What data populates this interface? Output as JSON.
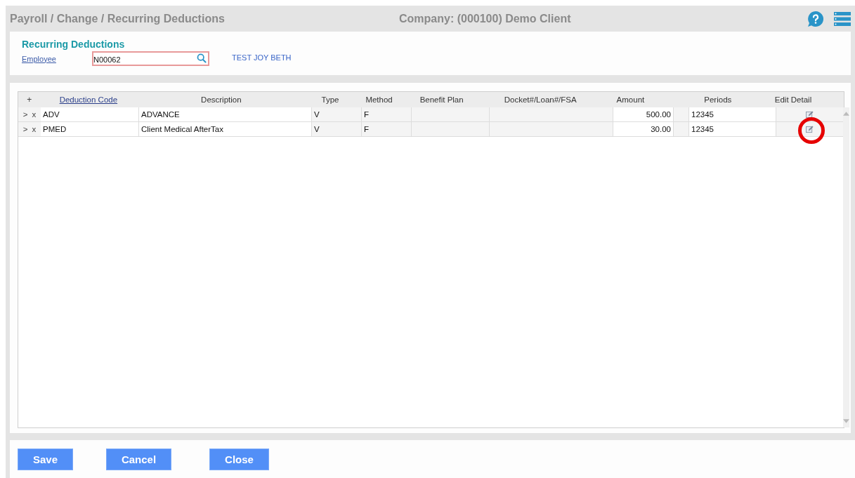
{
  "header": {
    "breadcrumb": "Payroll / Change / Recurring Deductions",
    "company": "Company: (000100) Demo Client"
  },
  "form": {
    "title": "Recurring Deductions",
    "employee_label": "Employee",
    "employee_value": "N00062",
    "employee_name": "TEST JOY BETH"
  },
  "table": {
    "add": "+",
    "columns": [
      {
        "label": "Deduction Code",
        "kind": "link"
      },
      {
        "label": "Description",
        "kind": "text"
      },
      {
        "label": "Type",
        "kind": "text"
      },
      {
        "label": "Method",
        "kind": "text"
      },
      {
        "label": "Benefit Plan",
        "kind": "text"
      },
      {
        "label": "Docket#/Loan#/FSA",
        "kind": "text"
      },
      {
        "label": "Amount",
        "kind": "text"
      },
      {
        "label": "Periods",
        "kind": "text"
      },
      {
        "label": "Edit Detail",
        "kind": "text"
      }
    ],
    "rows": [
      {
        "expand": ">",
        "remove": "x",
        "code": "ADV",
        "description": "ADVANCE",
        "type": "V",
        "method": "F",
        "benefit_plan": "",
        "docket": "",
        "amount": "500.00",
        "periods": "12345",
        "highlighted": false
      },
      {
        "expand": ">",
        "remove": "x",
        "code": "PMED",
        "description": "Client Medical AfterTax",
        "type": "V",
        "method": "F",
        "benefit_plan": "",
        "docket": "",
        "amount": "30.00",
        "periods": "12345",
        "highlighted": true
      }
    ]
  },
  "buttons": [
    "Save",
    "Cancel",
    "Close"
  ]
}
